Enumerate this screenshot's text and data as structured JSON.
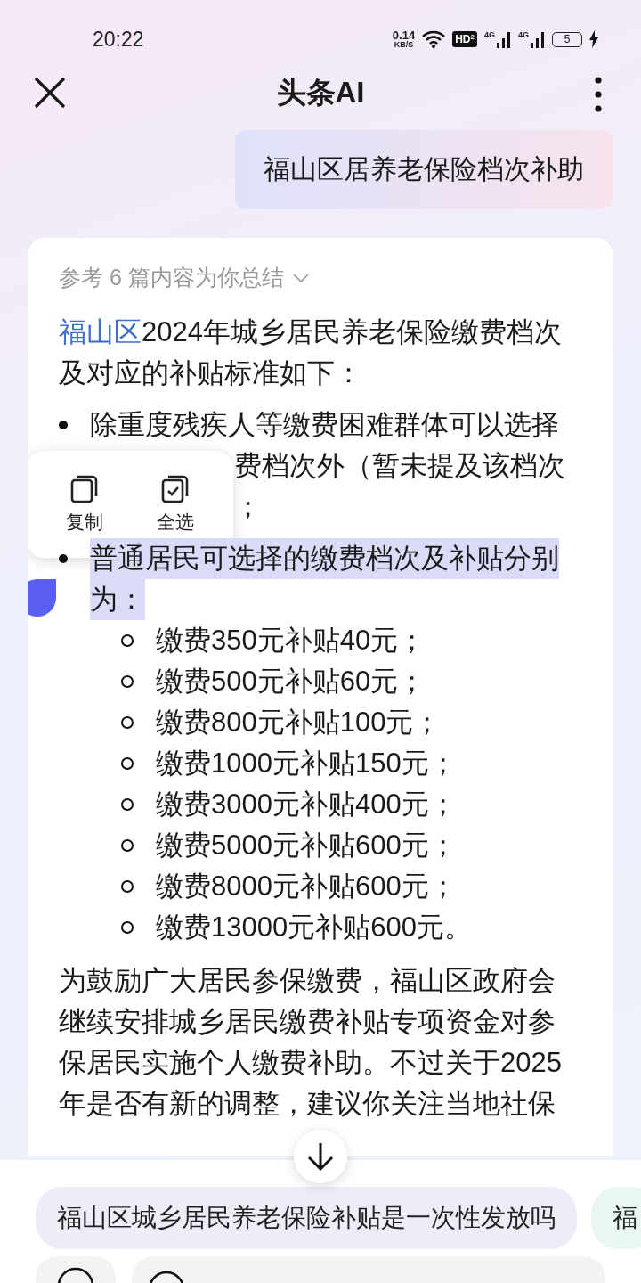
{
  "status_bar": {
    "time": "20:22",
    "net_speed": "0.14",
    "net_unit": "KB/S",
    "hd": "HD",
    "hd_slot": "2",
    "signals": [
      {
        "label": "4G"
      },
      {
        "label": "4G"
      }
    ],
    "battery": "5",
    "charging": true
  },
  "header": {
    "title": "头条AI"
  },
  "user_message": "福山区居养老保险档次补助",
  "answer": {
    "sources": "参考 6 篇内容为你总结",
    "intro_link": "福山区",
    "intro_text": "2024年城乡居民养老保险缴费档次及对应的补贴标准如下：",
    "bullets": [
      {
        "lines": [
          "除重度残疾人等缴费困难群体可以选择",
          "费档次外（暂未提及该档次",
          "；"
        ],
        "selected": false
      },
      {
        "lines": [
          "普通居民可选择的缴费档次及补贴分别",
          "为："
        ],
        "selected": true,
        "children": [
          "缴费350元补贴40元；",
          "缴费500元补贴60元；",
          "缴费800元补贴100元；",
          "缴费1000元补贴150元；",
          "缴费3000元补贴400元；",
          "缴费5000元补贴600元；",
          "缴费8000元补贴600元；",
          "缴费13000元补贴600元。"
        ]
      }
    ],
    "paragraph": "为鼓励广大居民参保缴费，福山区政府会继续安排城乡居民缴费补贴专项资金对参保居民实施个人缴费补助。不过关于2025年是否有新的调整，建议你关注当地社保"
  },
  "context_menu": [
    {
      "kind": "copy",
      "label": "复制"
    },
    {
      "kind": "select_all",
      "label": "全选"
    }
  ],
  "suggestions": [
    "福山区城乡居民养老保险补贴是一次性发放吗",
    "福"
  ]
}
